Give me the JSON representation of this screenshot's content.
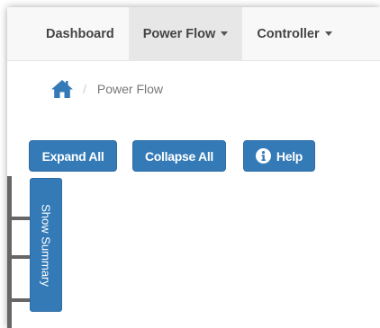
{
  "navbar": {
    "items": [
      {
        "label": "Dashboard"
      },
      {
        "label": "Power Flow"
      },
      {
        "label": "Controller"
      }
    ]
  },
  "breadcrumb": {
    "current": "Power Flow",
    "separator": "/"
  },
  "toolbar": {
    "expand_label": "Expand All",
    "collapse_label": "Collapse All",
    "help_label": "Help"
  },
  "summary_tab": {
    "label": "Show Summary"
  },
  "colors": {
    "primary": "#337ab7",
    "nav_background": "#f8f8f8",
    "nav_active": "#e7e7e7",
    "rail": "#666666"
  },
  "icons": {
    "home": "home-icon",
    "help": "info-circle-icon",
    "caret": "chevron-down-icon"
  }
}
